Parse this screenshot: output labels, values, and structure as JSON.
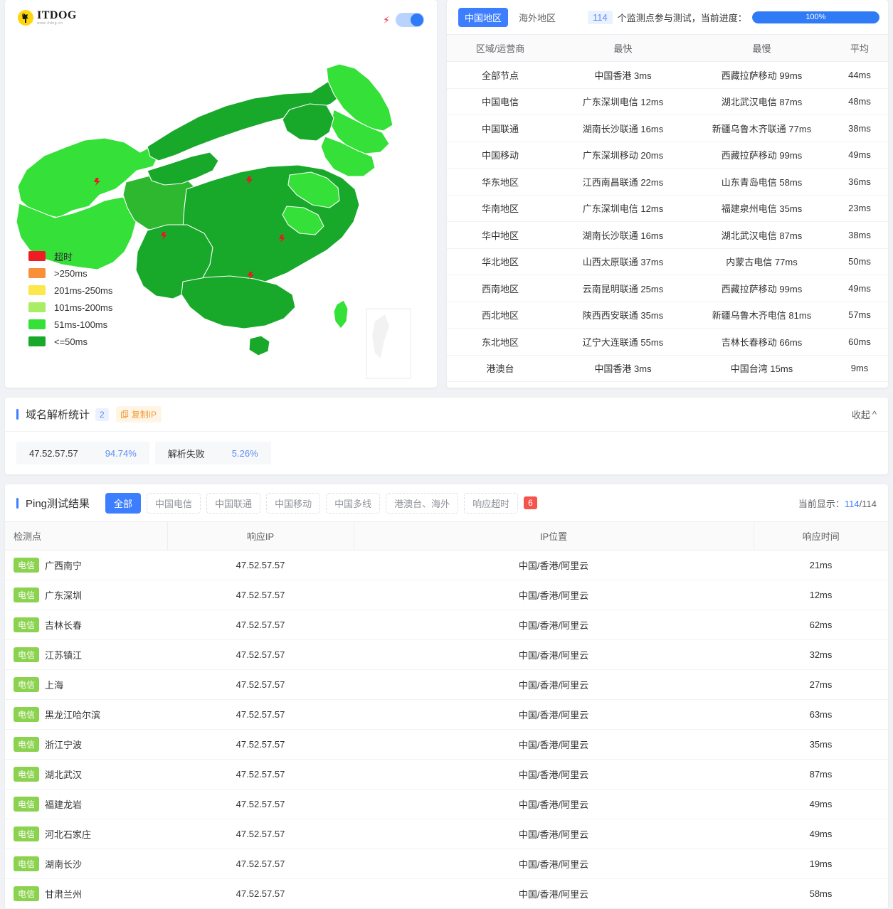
{
  "brand": {
    "name": "ITDOG",
    "sub": "www.itdog.cn",
    "logo_icon": "dog-icon"
  },
  "map_panel": {
    "bolt_icon": "lightning-bolt-icon",
    "toggle_on": true,
    "legend": [
      {
        "label": "超时",
        "color": "#ef1c24"
      },
      {
        "label": ">250ms",
        "color": "#f79038"
      },
      {
        "label": "201ms-250ms",
        "color": "#fae84c"
      },
      {
        "label": "101ms-200ms",
        "color": "#a8ed63"
      },
      {
        "label": "51ms-100ms",
        "color": "#35e038"
      },
      {
        "label": "<=50ms",
        "color": "#18a92b"
      }
    ]
  },
  "stat_panel": {
    "tabs": [
      {
        "label": "中国地区",
        "active": true
      },
      {
        "label": "海外地区",
        "active": false
      }
    ],
    "node_count": "114",
    "progress_text": "个监测点参与测试，当前进度：",
    "progress_value": "100%",
    "headers": [
      "区域/运营商",
      "最快",
      "最慢",
      "平均"
    ],
    "rows": [
      {
        "region": "全部节点",
        "fastest": "中国香港 3ms",
        "slowest": "西藏拉萨移动 99ms",
        "avg": "44ms"
      },
      {
        "region": "中国电信",
        "fastest": "广东深圳电信 12ms",
        "slowest": "湖北武汉电信 87ms",
        "avg": "48ms"
      },
      {
        "region": "中国联通",
        "fastest": "湖南长沙联通 16ms",
        "slowest": "新疆乌鲁木齐联通 77ms",
        "avg": "38ms"
      },
      {
        "region": "中国移动",
        "fastest": "广东深圳移动 20ms",
        "slowest": "西藏拉萨移动 99ms",
        "avg": "49ms"
      },
      {
        "region": "华东地区",
        "fastest": "江西南昌联通 22ms",
        "slowest": "山东青岛电信 58ms",
        "avg": "36ms"
      },
      {
        "region": "华南地区",
        "fastest": "广东深圳电信 12ms",
        "slowest": "福建泉州电信 35ms",
        "avg": "23ms"
      },
      {
        "region": "华中地区",
        "fastest": "湖南长沙联通 16ms",
        "slowest": "湖北武汉电信 87ms",
        "avg": "38ms"
      },
      {
        "region": "华北地区",
        "fastest": "山西太原联通 37ms",
        "slowest": "内蒙古电信 77ms",
        "avg": "50ms"
      },
      {
        "region": "西南地区",
        "fastest": "云南昆明联通 25ms",
        "slowest": "西藏拉萨移动 99ms",
        "avg": "49ms"
      },
      {
        "region": "西北地区",
        "fastest": "陕西西安联通 35ms",
        "slowest": "新疆乌鲁木齐电信 81ms",
        "avg": "57ms"
      },
      {
        "region": "东北地区",
        "fastest": "辽宁大连联通 55ms",
        "slowest": "吉林长春移动 66ms",
        "avg": "60ms"
      },
      {
        "region": "港澳台",
        "fastest": "中国香港 3ms",
        "slowest": "中国台湾 15ms",
        "avg": "9ms"
      }
    ]
  },
  "dns_panel": {
    "title": "域名解析统计",
    "count": "2",
    "copy_label": "复制IP",
    "copy_icon": "copy-icon",
    "collapse_label": "收起",
    "collapse_icon": "chevron-up-icon",
    "items": [
      {
        "name": "47.52.57.57",
        "pct": "94.74%"
      },
      {
        "name": "解析失败",
        "pct": "5.26%"
      }
    ]
  },
  "ping_panel": {
    "title": "Ping测试结果",
    "filters": [
      {
        "label": "全部",
        "active": true
      },
      {
        "label": "中国电信",
        "active": false
      },
      {
        "label": "中国联通",
        "active": false
      },
      {
        "label": "中国移动",
        "active": false
      },
      {
        "label": "中国多线",
        "active": false
      },
      {
        "label": "港澳台、海外",
        "active": false
      },
      {
        "label": "响应超时",
        "active": false
      }
    ],
    "timeout_count": "6",
    "showing_label": "当前显示：",
    "showing_current": "114",
    "showing_total": "/114",
    "headers": [
      "检测点",
      "响应IP",
      "IP位置",
      "响应时间"
    ],
    "rows": [
      {
        "isp": "电信",
        "node": "广西南宁",
        "ip": "47.52.57.57",
        "loc": "中国/香港/阿里云",
        "rt": "21ms"
      },
      {
        "isp": "电信",
        "node": "广东深圳",
        "ip": "47.52.57.57",
        "loc": "中国/香港/阿里云",
        "rt": "12ms"
      },
      {
        "isp": "电信",
        "node": "吉林长春",
        "ip": "47.52.57.57",
        "loc": "中国/香港/阿里云",
        "rt": "62ms"
      },
      {
        "isp": "电信",
        "node": "江苏镇江",
        "ip": "47.52.57.57",
        "loc": "中国/香港/阿里云",
        "rt": "32ms"
      },
      {
        "isp": "电信",
        "node": "上海",
        "ip": "47.52.57.57",
        "loc": "中国/香港/阿里云",
        "rt": "27ms"
      },
      {
        "isp": "电信",
        "node": "黑龙江哈尔滨",
        "ip": "47.52.57.57",
        "loc": "中国/香港/阿里云",
        "rt": "63ms"
      },
      {
        "isp": "电信",
        "node": "浙江宁波",
        "ip": "47.52.57.57",
        "loc": "中国/香港/阿里云",
        "rt": "35ms"
      },
      {
        "isp": "电信",
        "node": "湖北武汉",
        "ip": "47.52.57.57",
        "loc": "中国/香港/阿里云",
        "rt": "87ms"
      },
      {
        "isp": "电信",
        "node": "福建龙岩",
        "ip": "47.52.57.57",
        "loc": "中国/香港/阿里云",
        "rt": "49ms"
      },
      {
        "isp": "电信",
        "node": "河北石家庄",
        "ip": "47.52.57.57",
        "loc": "中国/香港/阿里云",
        "rt": "49ms"
      },
      {
        "isp": "电信",
        "node": "湖南长沙",
        "ip": "47.52.57.57",
        "loc": "中国/香港/阿里云",
        "rt": "19ms"
      },
      {
        "isp": "电信",
        "node": "甘肃兰州",
        "ip": "47.52.57.57",
        "loc": "中国/香港/阿里云",
        "rt": "58ms"
      }
    ]
  }
}
